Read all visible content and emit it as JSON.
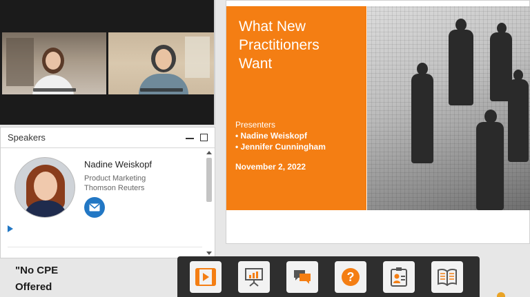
{
  "video": {
    "participants": [
      {
        "caption": ""
      },
      {
        "caption": ""
      }
    ]
  },
  "speakers_panel": {
    "title": "Speakers",
    "speaker": {
      "name": "Nadine Weiskopf",
      "role": "Product Marketing",
      "organization": "Thomson Reuters",
      "contact_icon": "mail-icon"
    }
  },
  "note": {
    "line1": "\"No CPE",
    "line2": "Offered"
  },
  "slide": {
    "title_line1": "What New",
    "title_line2": "Practitioners",
    "title_line3": "Want",
    "presenters_heading": "Presenters",
    "presenter_1": "•   Nadine Weiskopf",
    "presenter_2": "•   Jennifer Cunningham",
    "date": "November 2, 2022",
    "accent_color": "#f47e13"
  },
  "toolbar": {
    "buttons": [
      {
        "icon": "media-player-icon",
        "color": "#f47e13"
      },
      {
        "icon": "slides-icon",
        "color": "#f47e13"
      },
      {
        "icon": "chat-icon",
        "color": "#f47e13"
      },
      {
        "icon": "question-icon",
        "color": "#f47e13"
      },
      {
        "icon": "speaker-card-icon",
        "color": "#f47e13"
      },
      {
        "icon": "resources-book-icon",
        "color": "#f47e13"
      }
    ]
  }
}
